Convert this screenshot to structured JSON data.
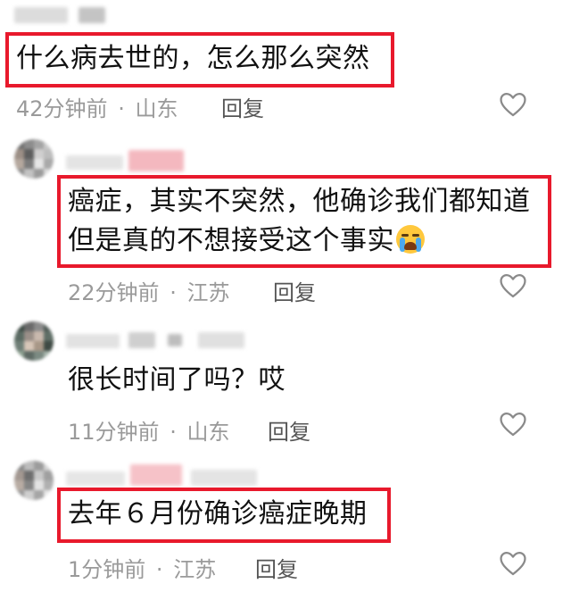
{
  "comments": [
    {
      "text_lines": [
        "什么病去世的，怎么那么突然"
      ],
      "time": "42分钟前",
      "location": "山东",
      "reply_label": "回复"
    },
    {
      "text_lines": [
        "癌症，其实不突然，他确诊我们都知道",
        "但是真的不想接受这个事实"
      ],
      "emoji": "crying-face",
      "time": "22分钟前",
      "location": "江苏",
      "reply_label": "回复"
    },
    {
      "text_lines": [
        "很长时间了吗？哎"
      ],
      "time": "11分钟前",
      "location": "山东",
      "reply_label": "回复"
    },
    {
      "text_lines": [
        "去年６月份确诊癌症晚期"
      ],
      "time": "1分钟前",
      "location": "江苏",
      "reply_label": "回复"
    }
  ],
  "meta_separator": "·",
  "icons": {
    "like": "heart-outline-icon"
  },
  "colors": {
    "highlight": "#e8192c",
    "meta": "#9a9a9a",
    "text": "#111111"
  }
}
